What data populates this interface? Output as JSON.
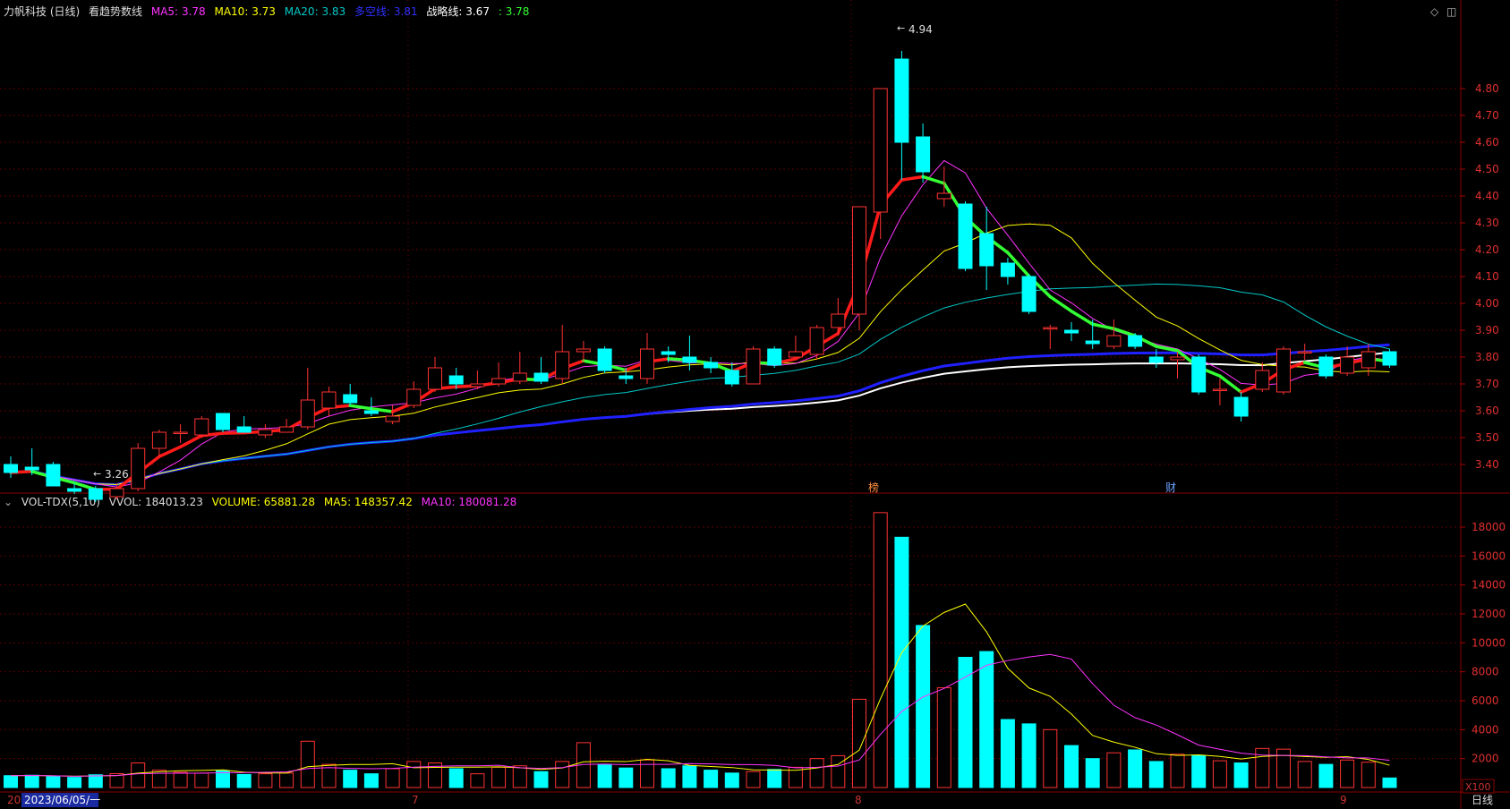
{
  "header": {
    "stock": "力帆科技 (日线)",
    "indicator": "看趋势数线",
    "ma5": {
      "label": "MA5:",
      "value": "3.78",
      "color": "#ff33ff"
    },
    "ma10": {
      "label": "MA10:",
      "value": "3.73",
      "color": "#ffff00"
    },
    "ma20": {
      "label": "MA20:",
      "value": "3.83",
      "color": "#00c8c8"
    },
    "dkx": {
      "label": "多空线:",
      "value": "3.81",
      "color": "#3030ff"
    },
    "strategy": {
      "label": "战略线:",
      "value": "3.67",
      "color": "#ffffff"
    },
    "trend": {
      "label": ":",
      "value": "3.78",
      "color": "#33ff33"
    }
  },
  "vol_header": {
    "name": "VOL-TDX(5,10)",
    "vvol": "VVOL: 184013.23",
    "volume": "VOLUME: 65881.28",
    "ma5": "MA5: 148357.42",
    "ma10": "MA10: 180081.28"
  },
  "annotations": {
    "high": "4.94",
    "low": "3.26",
    "marker1": "榜",
    "marker2": "财"
  },
  "axis_bottom": {
    "start_date": "2023/06/05/一",
    "m7": "7",
    "m8": "8",
    "m9": "9",
    "left_cut": "20"
  },
  "price_axis": [
    "4.80",
    "4.70",
    "4.60",
    "4.50",
    "4.40",
    "4.30",
    "4.20",
    "4.10",
    "4.00",
    "3.90",
    "3.80",
    "3.70",
    "3.60",
    "3.50",
    "3.40"
  ],
  "volume_axis": [
    "18000",
    "16000",
    "14000",
    "12000",
    "10000",
    "8000",
    "6000",
    "4000",
    "2000"
  ],
  "volume_unit": "X100",
  "period_tab": "日线",
  "colors": {
    "up": "#ff3232",
    "down": "#00ffff",
    "bg": "#000000",
    "grid": "#5a0000"
  },
  "chart_data": {
    "type": "candlestick",
    "candles": [
      {
        "o": 3.4,
        "c": 3.37,
        "h": 3.43,
        "l": 3.35,
        "v": 820
      },
      {
        "o": 3.39,
        "c": 3.38,
        "h": 3.46,
        "l": 3.36,
        "v": 850
      },
      {
        "o": 3.4,
        "c": 3.32,
        "h": 3.41,
        "l": 3.32,
        "v": 760
      },
      {
        "o": 3.31,
        "c": 3.3,
        "h": 3.33,
        "l": 3.29,
        "v": 700
      },
      {
        "o": 3.31,
        "c": 3.27,
        "h": 3.32,
        "l": 3.26,
        "v": 880
      },
      {
        "o": 3.28,
        "c": 3.31,
        "h": 3.33,
        "l": 3.27,
        "v": 960
      },
      {
        "o": 3.31,
        "c": 3.46,
        "h": 3.48,
        "l": 3.3,
        "v": 1700
      },
      {
        "o": 3.46,
        "c": 3.52,
        "h": 3.53,
        "l": 3.43,
        "v": 1200
      },
      {
        "o": 3.52,
        "c": 3.52,
        "h": 3.55,
        "l": 3.48,
        "v": 1050
      },
      {
        "o": 3.51,
        "c": 3.57,
        "h": 3.58,
        "l": 3.5,
        "v": 1000
      },
      {
        "o": 3.59,
        "c": 3.53,
        "h": 3.59,
        "l": 3.52,
        "v": 1150
      },
      {
        "o": 3.54,
        "c": 3.52,
        "h": 3.58,
        "l": 3.52,
        "v": 900
      },
      {
        "o": 3.51,
        "c": 3.53,
        "h": 3.55,
        "l": 3.5,
        "v": 950
      },
      {
        "o": 3.52,
        "c": 3.54,
        "h": 3.57,
        "l": 3.52,
        "v": 1000
      },
      {
        "o": 3.54,
        "c": 3.64,
        "h": 3.76,
        "l": 3.53,
        "v": 3200
      },
      {
        "o": 3.61,
        "c": 3.67,
        "h": 3.69,
        "l": 3.58,
        "v": 1600
      },
      {
        "o": 3.66,
        "c": 3.63,
        "h": 3.7,
        "l": 3.62,
        "v": 1200
      },
      {
        "o": 3.6,
        "c": 3.59,
        "h": 3.65,
        "l": 3.58,
        "v": 950
      },
      {
        "o": 3.56,
        "c": 3.58,
        "h": 3.62,
        "l": 3.55,
        "v": 1300
      },
      {
        "o": 3.62,
        "c": 3.68,
        "h": 3.71,
        "l": 3.61,
        "v": 1800
      },
      {
        "o": 3.68,
        "c": 3.76,
        "h": 3.8,
        "l": 3.67,
        "v": 1700
      },
      {
        "o": 3.73,
        "c": 3.7,
        "h": 3.76,
        "l": 3.68,
        "v": 1300
      },
      {
        "o": 3.69,
        "c": 3.7,
        "h": 3.75,
        "l": 3.68,
        "v": 950
      },
      {
        "o": 3.7,
        "c": 3.72,
        "h": 3.78,
        "l": 3.69,
        "v": 1400
      },
      {
        "o": 3.71,
        "c": 3.74,
        "h": 3.82,
        "l": 3.7,
        "v": 1500
      },
      {
        "o": 3.74,
        "c": 3.71,
        "h": 3.8,
        "l": 3.7,
        "v": 1100
      },
      {
        "o": 3.72,
        "c": 3.82,
        "h": 3.92,
        "l": 3.7,
        "v": 1800
      },
      {
        "o": 3.82,
        "c": 3.83,
        "h": 3.86,
        "l": 3.78,
        "v": 3100
      },
      {
        "o": 3.83,
        "c": 3.75,
        "h": 3.84,
        "l": 3.74,
        "v": 1600
      },
      {
        "o": 3.73,
        "c": 3.72,
        "h": 3.76,
        "l": 3.7,
        "v": 1350
      },
      {
        "o": 3.72,
        "c": 3.83,
        "h": 3.89,
        "l": 3.7,
        "v": 1900
      },
      {
        "o": 3.82,
        "c": 3.81,
        "h": 3.84,
        "l": 3.78,
        "v": 1300
      },
      {
        "o": 3.8,
        "c": 3.78,
        "h": 3.88,
        "l": 3.75,
        "v": 1500
      },
      {
        "o": 3.78,
        "c": 3.76,
        "h": 3.8,
        "l": 3.74,
        "v": 1200
      },
      {
        "o": 3.75,
        "c": 3.7,
        "h": 3.78,
        "l": 3.69,
        "v": 1000
      },
      {
        "o": 3.7,
        "c": 3.83,
        "h": 3.84,
        "l": 3.7,
        "v": 1100
      },
      {
        "o": 3.83,
        "c": 3.77,
        "h": 3.84,
        "l": 3.76,
        "v": 1250
      },
      {
        "o": 3.8,
        "c": 3.82,
        "h": 3.88,
        "l": 3.8,
        "v": 1400
      },
      {
        "o": 3.81,
        "c": 3.91,
        "h": 3.92,
        "l": 3.79,
        "v": 2000
      },
      {
        "o": 3.91,
        "c": 3.96,
        "h": 4.02,
        "l": 3.88,
        "v": 2200
      },
      {
        "o": 3.96,
        "c": 4.36,
        "h": 4.36,
        "l": 3.9,
        "v": 6100
      },
      {
        "o": 4.34,
        "c": 4.8,
        "h": 4.8,
        "l": 4.24,
        "v": 19000
      },
      {
        "o": 4.91,
        "c": 4.6,
        "h": 4.94,
        "l": 4.46,
        "v": 17300
      },
      {
        "o": 4.62,
        "c": 4.49,
        "h": 4.67,
        "l": 4.45,
        "v": 11200
      },
      {
        "o": 4.39,
        "c": 4.41,
        "h": 4.51,
        "l": 4.36,
        "v": 6900
      },
      {
        "o": 4.37,
        "c": 4.13,
        "h": 4.38,
        "l": 4.12,
        "v": 9000
      },
      {
        "o": 4.26,
        "c": 4.14,
        "h": 4.36,
        "l": 4.05,
        "v": 9400
      },
      {
        "o": 4.15,
        "c": 4.1,
        "h": 4.17,
        "l": 4.07,
        "v": 4700
      },
      {
        "o": 4.1,
        "c": 3.97,
        "h": 4.11,
        "l": 3.96,
        "v": 4400
      },
      {
        "o": 3.91,
        "c": 3.91,
        "h": 3.92,
        "l": 3.83,
        "v": 4000
      },
      {
        "o": 3.9,
        "c": 3.89,
        "h": 3.93,
        "l": 3.86,
        "v": 2900
      },
      {
        "o": 3.86,
        "c": 3.85,
        "h": 3.94,
        "l": 3.83,
        "v": 2000
      },
      {
        "o": 3.84,
        "c": 3.88,
        "h": 3.94,
        "l": 3.83,
        "v": 2400
      },
      {
        "o": 3.88,
        "c": 3.84,
        "h": 3.89,
        "l": 3.83,
        "v": 2600
      },
      {
        "o": 3.8,
        "c": 3.78,
        "h": 3.83,
        "l": 3.76,
        "v": 1800
      },
      {
        "o": 3.79,
        "c": 3.8,
        "h": 3.82,
        "l": 3.72,
        "v": 2300
      },
      {
        "o": 3.8,
        "c": 3.67,
        "h": 3.81,
        "l": 3.66,
        "v": 2200
      },
      {
        "o": 3.68,
        "c": 3.68,
        "h": 3.72,
        "l": 3.62,
        "v": 1850
      },
      {
        "o": 3.65,
        "c": 3.58,
        "h": 3.67,
        "l": 3.56,
        "v": 1700
      },
      {
        "o": 3.68,
        "c": 3.75,
        "h": 3.78,
        "l": 3.67,
        "v": 2700
      },
      {
        "o": 3.67,
        "c": 3.83,
        "h": 3.84,
        "l": 3.66,
        "v": 2650
      },
      {
        "o": 3.82,
        "c": 3.82,
        "h": 3.85,
        "l": 3.79,
        "v": 1800
      },
      {
        "o": 3.8,
        "c": 3.73,
        "h": 3.81,
        "l": 3.72,
        "v": 1600
      },
      {
        "o": 3.74,
        "c": 3.8,
        "h": 3.84,
        "l": 3.73,
        "v": 1900
      },
      {
        "o": 3.76,
        "c": 3.82,
        "h": 3.85,
        "l": 3.73,
        "v": 1750
      },
      {
        "o": 3.82,
        "c": 3.77,
        "h": 3.83,
        "l": 3.76,
        "v": 659
      }
    ],
    "price_range": [
      3.26,
      4.94
    ],
    "volume_range": [
      0,
      19000
    ]
  }
}
